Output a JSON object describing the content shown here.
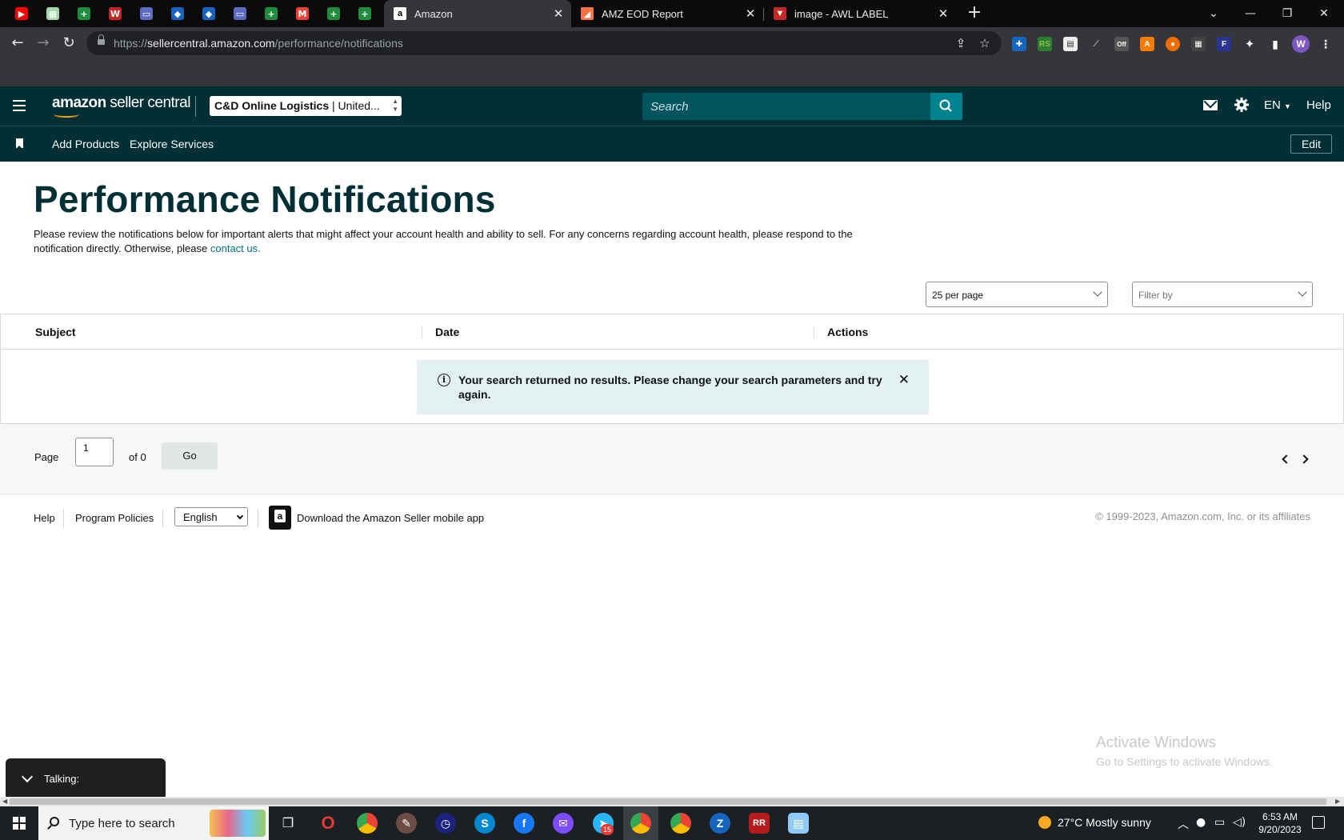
{
  "browser": {
    "pinned_tabs": [
      {
        "icon": "youtube-icon",
        "glyph": "▶",
        "color": "#ff0000"
      },
      {
        "icon": "sheets-icon",
        "glyph": "▦",
        "color": "#a5d6a7"
      },
      {
        "icon": "sheets-plus-icon",
        "glyph": "+",
        "color": "#1e8e3e"
      },
      {
        "icon": "w-app-icon",
        "glyph": "W",
        "color": "#c62828"
      },
      {
        "icon": "window-icon",
        "glyph": "▭",
        "color": "#5c6bc0"
      },
      {
        "icon": "diamond-app-icon",
        "glyph": "◆",
        "color": "#1565c0"
      },
      {
        "icon": "diamond-app-icon-2",
        "glyph": "◆",
        "color": "#1565c0"
      },
      {
        "icon": "window-icon-2",
        "glyph": "▭",
        "color": "#5c6bc0"
      },
      {
        "icon": "sheets-plus-icon-2",
        "glyph": "+",
        "color": "#1e8e3e"
      },
      {
        "icon": "gmail-icon",
        "glyph": "M",
        "color": "#ea4335"
      },
      {
        "icon": "sheets-plus-icon-3",
        "glyph": "+",
        "color": "#1e8e3e"
      },
      {
        "icon": "sheets-plus-icon-4",
        "glyph": "+",
        "color": "#1e8e3e"
      }
    ],
    "tabs": [
      {
        "title": "Amazon",
        "active": true
      },
      {
        "title": "AMZ EOD Report",
        "active": false
      },
      {
        "title": "image - AWL LABEL",
        "active": false
      }
    ],
    "url_prefix": "https://",
    "url_host": "sellercentral.amazon.com",
    "url_path": "/performance/notifications",
    "profile_initial": "W",
    "accent": "#7e57c2"
  },
  "header": {
    "logo_brand": "amazon",
    "logo_product": "seller central",
    "account": "C&D Online Logistics",
    "account_region": "United...",
    "search_placeholder": "Search",
    "language": "EN",
    "help": "Help"
  },
  "subnav": {
    "items": [
      "Add Products",
      "Explore Services"
    ],
    "edit": "Edit"
  },
  "main": {
    "title": "Performance Notifications",
    "intro_text": "Please review the notifications below for important alerts that might affect your account health and ability to sell. For any concerns regarding account health, please respond to the notification directly. Otherwise, please ",
    "intro_link": "contact us.",
    "per_page": "25 per page",
    "filter_placeholder": "Filter by",
    "columns": [
      "Subject",
      "Date",
      "Actions"
    ],
    "alert": "Your search returned no results. Please change your search parameters and try again.",
    "pager": {
      "page_label": "Page",
      "page_value": "1",
      "of_label": "of 0",
      "go": "Go"
    }
  },
  "footer": {
    "help": "Help",
    "policies": "Program Policies",
    "language": "English",
    "app_text": "Download the Amazon Seller mobile app",
    "copyright": "© 1999-2023, Amazon.com, Inc. or its affiliates"
  },
  "overlays": {
    "talking": "Talking:",
    "watermark_title": "Activate Windows",
    "watermark_sub": "Go to Settings to activate Windows."
  },
  "taskbar": {
    "search_placeholder": "Type here to search",
    "telegram_badge": "15",
    "weather": "27°C  Mostly sunny",
    "time": "6:53 AM",
    "date": "9/20/2023"
  },
  "colors": {
    "header_bg": "#002f36",
    "search_bg": "#00545e",
    "search_btn": "#00838f",
    "link": "#007185",
    "alert_bg": "#e3f1f3"
  }
}
